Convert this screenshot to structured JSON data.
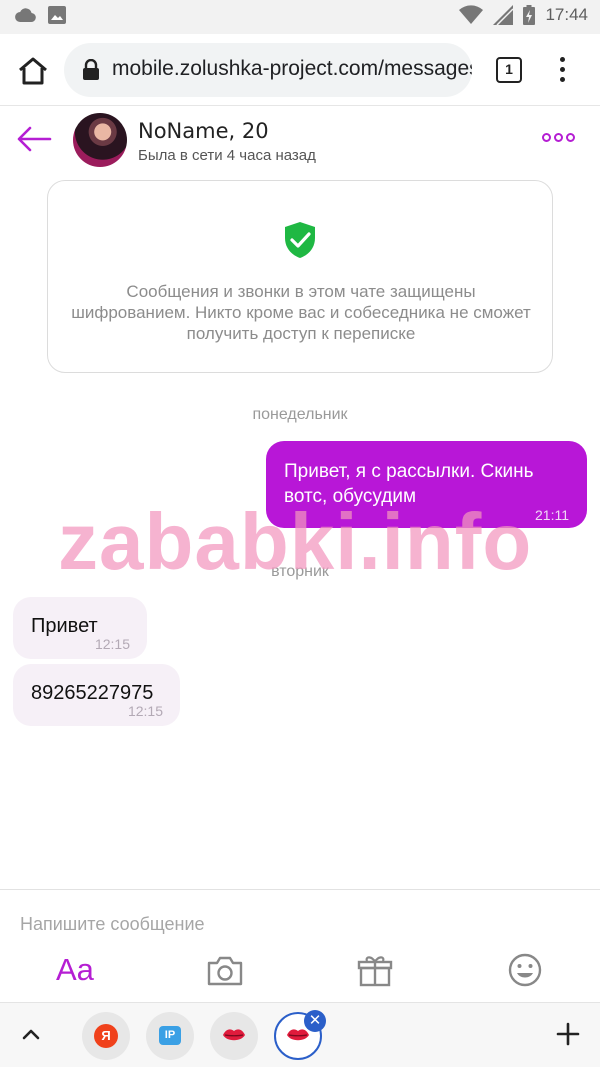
{
  "status_bar": {
    "time": "17:44",
    "icons": [
      "cloud-icon",
      "image-icon",
      "wifi-icon",
      "signal-icon",
      "battery-icon"
    ]
  },
  "browser": {
    "url": "mobile.zolushka-project.com/messages",
    "tab_count": "1"
  },
  "chat": {
    "contact_name": "NoName, 20",
    "contact_status": "Была в сети 4 часа назад",
    "accent_color": "#b817d7"
  },
  "notice": {
    "text": "Сообщения и звонки в этом чате защищены шифрованием. Никто кроме вас и собеседника не сможет получить доступ к переписке"
  },
  "days": [
    "понедельник",
    "вторник"
  ],
  "messages": [
    {
      "direction": "out",
      "text": "Привет, я с рассылки. Скинь вотс, обусудим",
      "time": "21:11"
    },
    {
      "direction": "in",
      "text": "Привет",
      "time": "12:15"
    },
    {
      "direction": "in",
      "text": "89265227975",
      "time": "12:15"
    }
  ],
  "watermark": "zababki.info",
  "composer": {
    "placeholder": "Напишите сообщение",
    "format_label": "Aa",
    "tools": [
      "format-text-button",
      "camera-icon",
      "gift-icon",
      "emoji-icon"
    ]
  },
  "bottom_bar": {
    "ya_label": "Я",
    "ip_label": "IP",
    "close_label": "✕",
    "tabs": [
      "yandex-tab",
      "ip-tab",
      "lips-tab",
      "lips-tab-active"
    ]
  }
}
